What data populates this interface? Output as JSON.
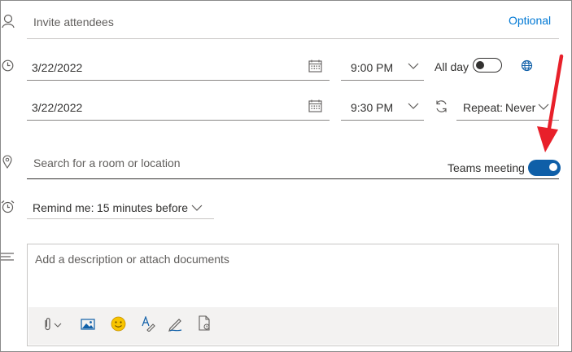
{
  "attendees": {
    "placeholder": "Invite attendees",
    "optional_label": "Optional"
  },
  "start": {
    "date": "3/22/2022",
    "time": "9:00 PM"
  },
  "all_day": {
    "label": "All day",
    "on": false
  },
  "end": {
    "date": "3/22/2022",
    "time": "9:30 PM"
  },
  "repeat": {
    "label": "Repeat:",
    "value": "Never"
  },
  "location": {
    "placeholder": "Search for a room or location"
  },
  "teams": {
    "label": "Teams meeting",
    "on": true
  },
  "remind": {
    "label": "Remind me:",
    "value": "15 minutes before"
  },
  "description": {
    "placeholder": "Add a description or attach documents"
  },
  "colors": {
    "accent": "#0f5fa8",
    "link": "#0078d4",
    "annotation": "#e8202a",
    "emoji": "#f7c400"
  },
  "icons": [
    "person-icon",
    "clock-icon",
    "calendar-icon",
    "chevron-down-icon",
    "globe-icon",
    "repeat-icon",
    "location-pin-icon",
    "alarm-clock-icon",
    "text-align-icon",
    "paperclip-icon",
    "image-icon",
    "emoji-icon",
    "format-text-icon",
    "pen-icon",
    "document-icon",
    "red-arrow-annotation"
  ]
}
